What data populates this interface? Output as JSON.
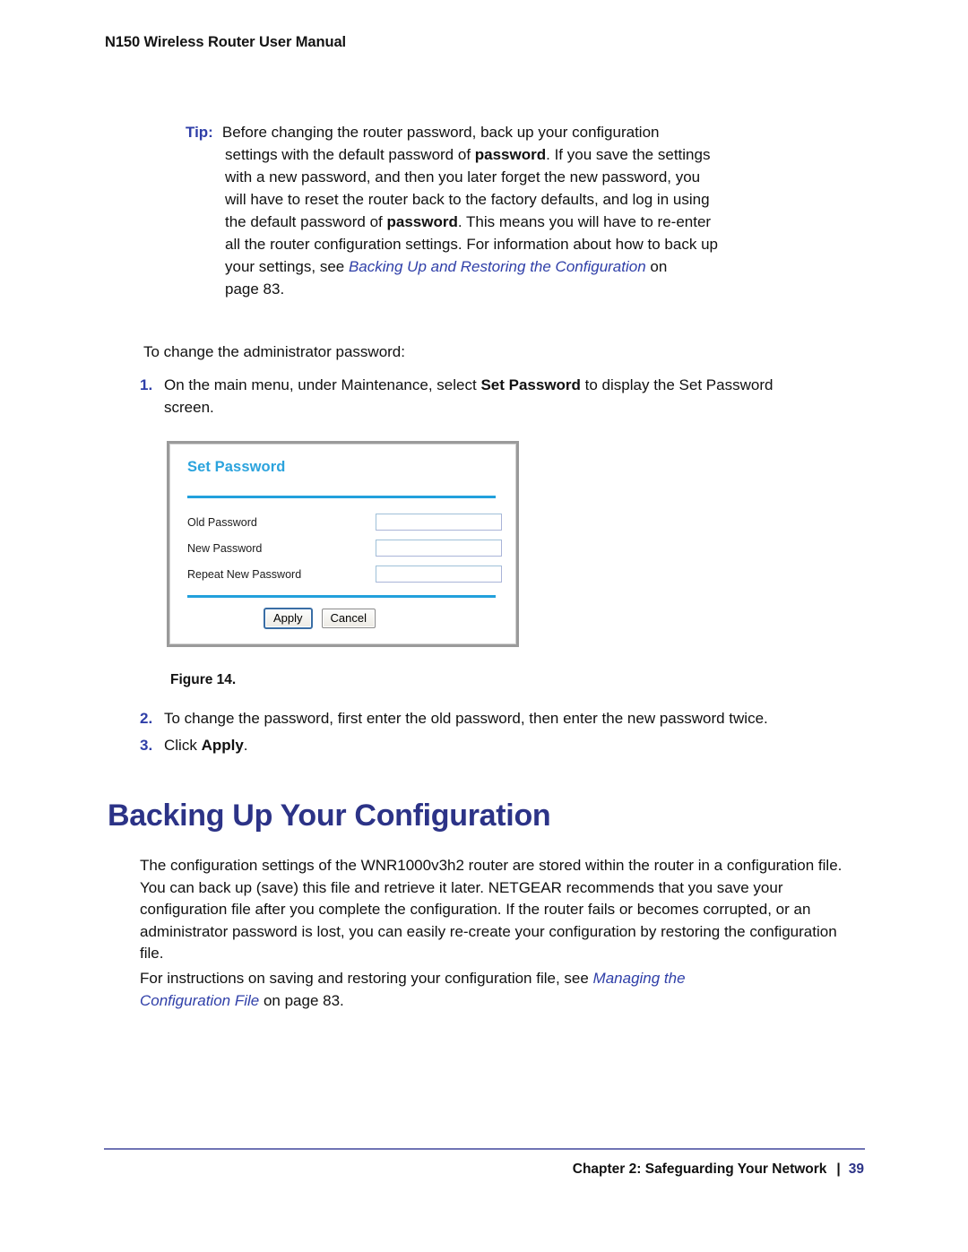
{
  "header": {
    "running_title": "N150 Wireless Router User Manual"
  },
  "tip": {
    "label": "Tip:",
    "line1": "Before changing the router password, back up your configuration",
    "line2_a": "settings with the default password of ",
    "line2_bold": "password",
    "line2_b": ". If you save the settings",
    "line3": "with a new password, and then you later forget the new password, you",
    "line4": "will have to reset the router back to the factory defaults, and log in using",
    "line5_a": "the default password of ",
    "line5_bold": "password",
    "line5_b": ". This means you will have to re-enter",
    "line6": "all the router configuration settings. For information about how to back up",
    "line7_a": "your settings, see ",
    "line7_xref": "Backing Up and Restoring the Configuration",
    "line7_b": " on",
    "line8": "page 83."
  },
  "lead_in": "To change the administrator password:",
  "steps": [
    {
      "number": "1.",
      "text_a": "On the main menu, under Maintenance, select ",
      "bold": "Set Password",
      "text_b": " to display the Set Password screen."
    },
    {
      "number": "2.",
      "text_a": "To change the password, first enter the old password, then enter the new password twice.",
      "bold": "",
      "text_b": ""
    },
    {
      "number": "3.",
      "text_a": "Click ",
      "bold": "Apply",
      "text_b": "."
    }
  ],
  "figure": {
    "caption": "Figure 14.",
    "screen": {
      "title": "Set Password",
      "fields": [
        {
          "label": "Old Password",
          "value": "",
          "placeholder": ""
        },
        {
          "label": "New Password",
          "value": "",
          "placeholder": ""
        },
        {
          "label": "Repeat New Password",
          "value": "",
          "placeholder": ""
        }
      ],
      "buttons": [
        {
          "label": "Apply",
          "style": "default"
        },
        {
          "label": "Cancel",
          "style": "normal"
        }
      ],
      "accent_color": "#22a0dc",
      "frame_color": "#9a9a9a"
    }
  },
  "section": {
    "heading": "Backing Up Your Configuration",
    "heading_color": "#2c3387",
    "para1": "The configuration settings of the WNR1000v3h2 router are stored within the router in a configuration file. You can back up (save) this file and retrieve it later. NETGEAR recommends that you save your configuration file after you complete the configuration. If the router fails or becomes corrupted, or an administrator password is lost, you can easily re-create your configuration by restoring the configuration file.",
    "para2_a": "For instructions on saving and restoring your configuration file, see ",
    "para2_xref": "Managing the Configuration File",
    "para2_b": " on page 83."
  },
  "footer": {
    "chapter": "Chapter 2:  Safeguarding Your Network",
    "separator": "|",
    "page_number": "39",
    "rule_color": "#6f74b4"
  }
}
